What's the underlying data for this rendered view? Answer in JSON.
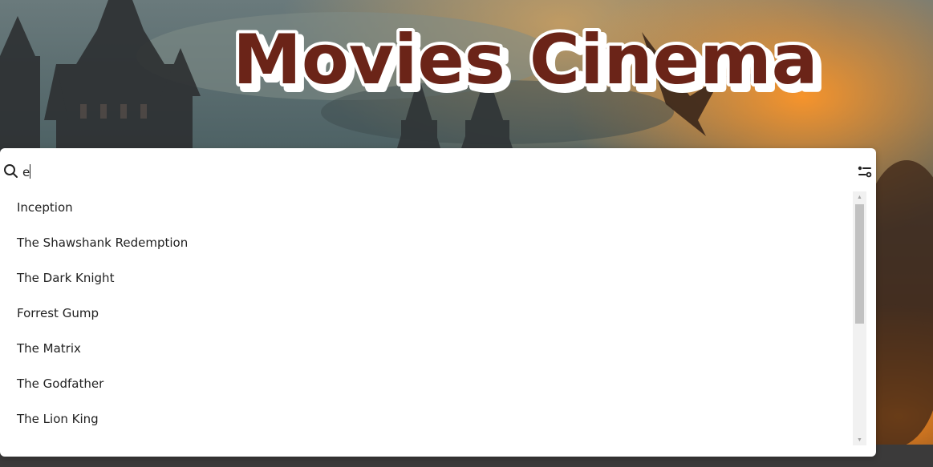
{
  "app": {
    "title": "Movies Cinema"
  },
  "search": {
    "value": "e",
    "placeholder": ""
  },
  "results": [
    "Inception",
    "The Shawshank Redemption",
    "The Dark Knight",
    "Forrest Gump",
    "The Matrix",
    "The Godfather",
    "The Lion King"
  ],
  "scrollbar": {
    "up_glyph": "▲",
    "down_glyph": "▼",
    "scroll_fraction": 0
  },
  "colors": {
    "title_fill": "#6b2418",
    "title_outline": "#ffffff",
    "panel_bg": "#ffffff",
    "text": "#222222"
  }
}
